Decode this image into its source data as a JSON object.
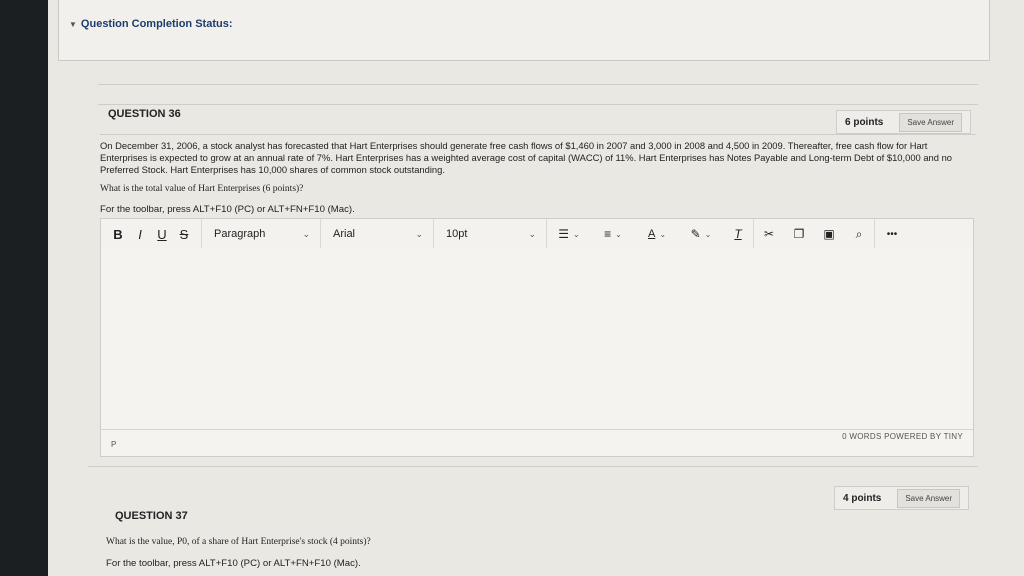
{
  "status": {
    "label": "Question Completion Status:"
  },
  "q36": {
    "title": "QUESTION 36",
    "points": "6 points",
    "save_label": "Save Answer",
    "text": "On December 31, 2006, a stock analyst has forecasted that Hart Enterprises should generate free cash flows of $1,460 in 2007 and 3,000 in 2008 and 4,500 in 2009.  Thereafter, free cash flow for Hart Enterprises is expected to grow at an annual rate of 7%.  Hart Enterprises has a weighted average cost of capital (WACC) of 11%.  Hart Enterprises has Notes Payable and Long-term Debt of $10,000 and no Preferred Stock.  Hart Enterprises has 10,000 shares of common stock outstanding.",
    "prompt": "What is the total value of Hart Enterprises (6 points)?",
    "hint": "For the toolbar, press ALT+F10 (PC) or ALT+FN+F10 (Mac)."
  },
  "toolbar": {
    "bold": "B",
    "italic": "I",
    "underline": "U",
    "strike": "S",
    "paragraph": "Paragraph",
    "font": "Arial",
    "size": "10pt",
    "more": "•••"
  },
  "editor": {
    "path": "P",
    "word_count": "0 WORDS  POWERED BY TINY"
  },
  "q37": {
    "title": "QUESTION 37",
    "points": "4 points",
    "save_label": "Save Answer",
    "prompt": "What is the value, P0, of a share of Hart Enterprise's stock (4 points)?",
    "hint": "For the toolbar, press ALT+F10 (PC) or ALT+FN+F10 (Mac)."
  }
}
